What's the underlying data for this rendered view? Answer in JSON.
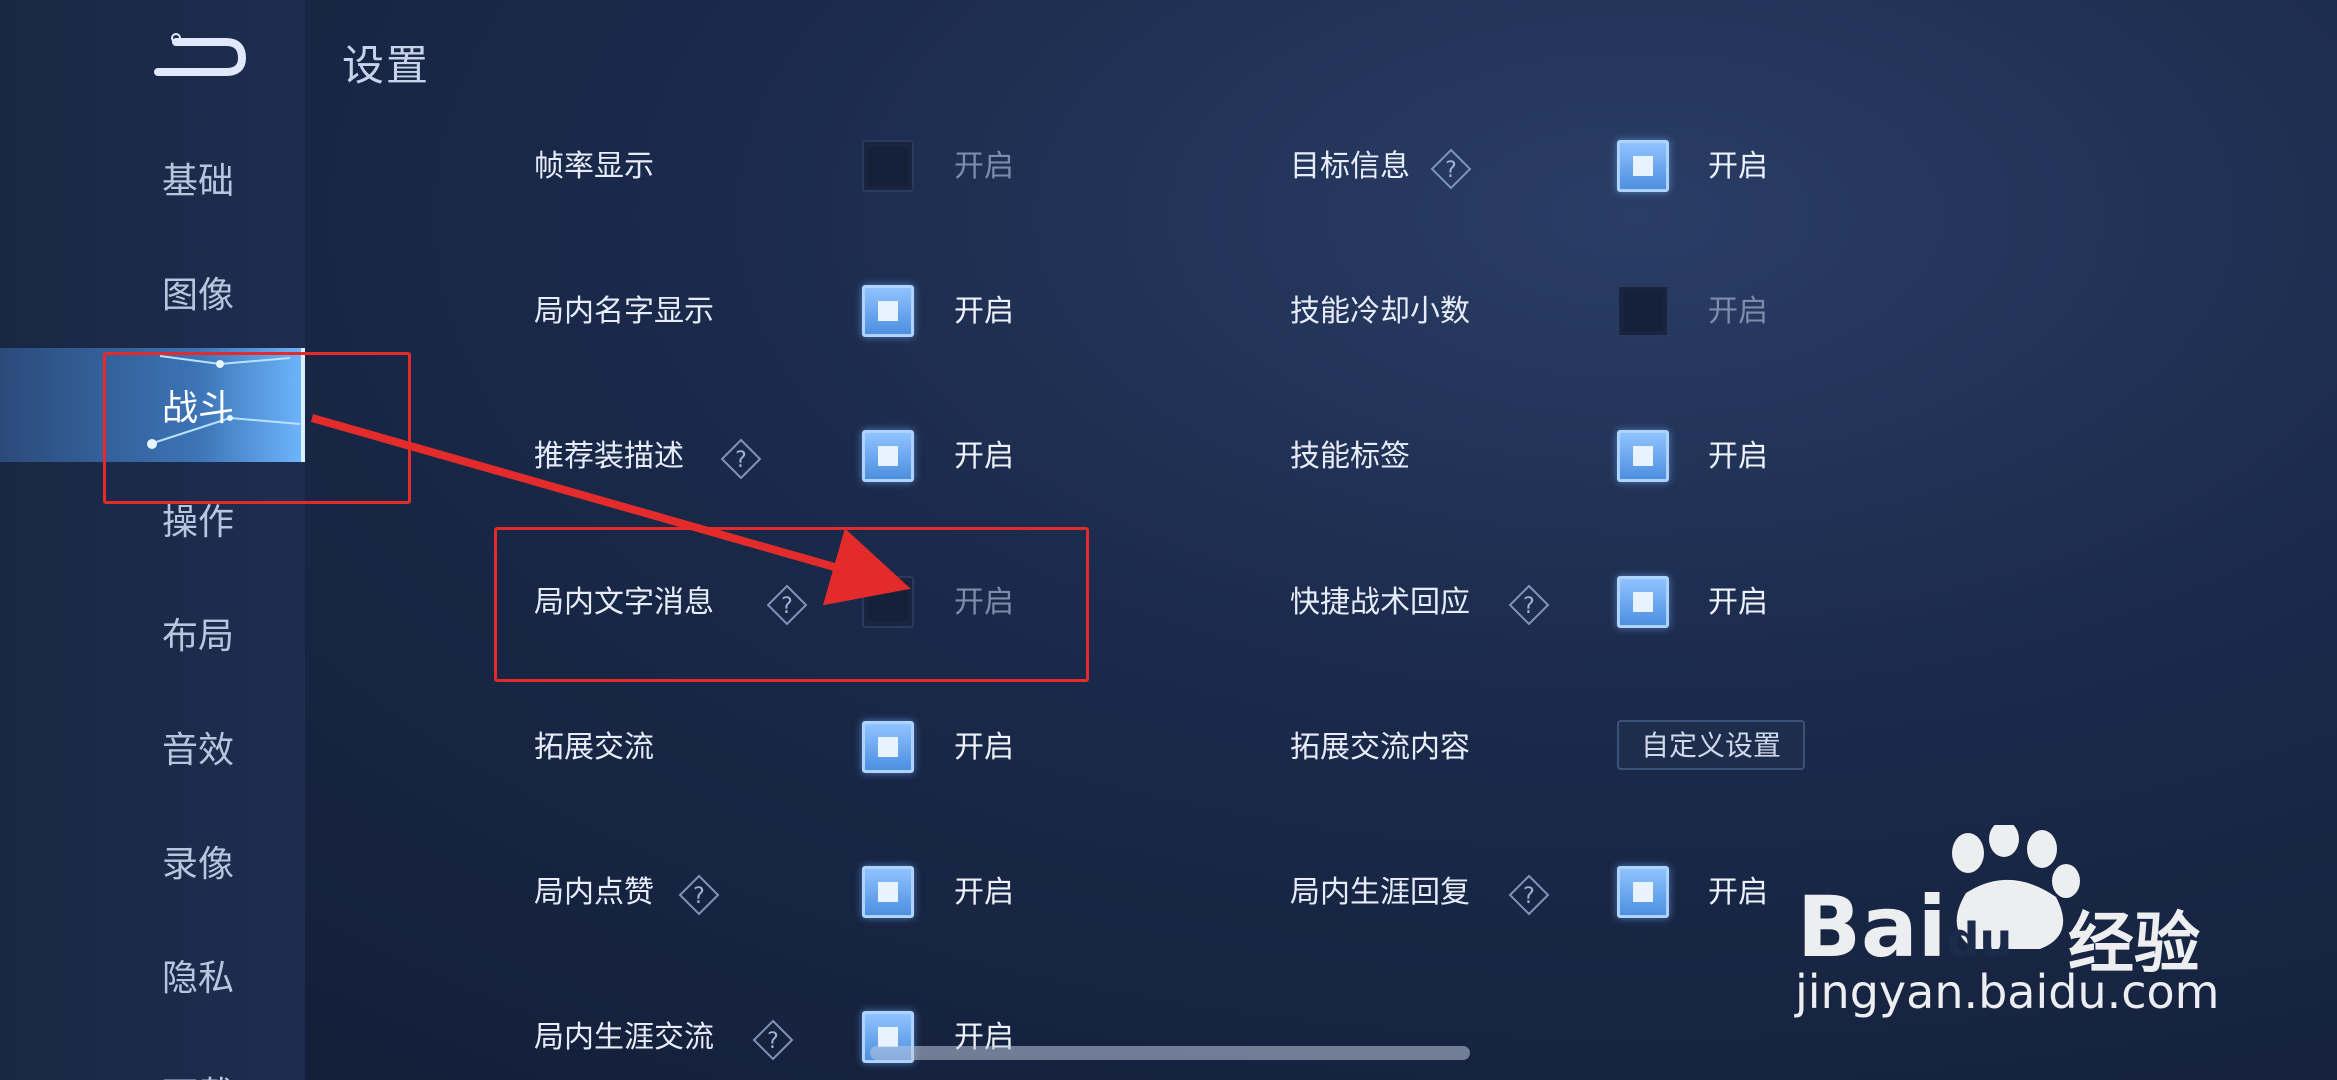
{
  "header": {
    "title": "设置"
  },
  "sidebar": {
    "items": [
      {
        "label": "基础",
        "active": false
      },
      {
        "label": "图像",
        "active": false
      },
      {
        "label": "战斗",
        "active": true
      },
      {
        "label": "操作",
        "active": false
      },
      {
        "label": "布局",
        "active": false
      },
      {
        "label": "音效",
        "active": false
      },
      {
        "label": "录像",
        "active": false
      },
      {
        "label": "隐私",
        "active": false
      },
      {
        "label": "下载",
        "active": false
      }
    ]
  },
  "settings": {
    "left": [
      {
        "label": "帧率显示",
        "help": false,
        "checked": false,
        "toggle_label": "开启"
      },
      {
        "label": "局内名字显示",
        "help": false,
        "checked": true,
        "toggle_label": "开启"
      },
      {
        "label": "推荐装描述",
        "help": true,
        "checked": true,
        "toggle_label": "开启"
      },
      {
        "label": "局内文字消息",
        "help": true,
        "checked": false,
        "toggle_label": "开启"
      },
      {
        "label": "拓展交流",
        "help": false,
        "checked": true,
        "toggle_label": "开启"
      },
      {
        "label": "局内点赞",
        "help": true,
        "checked": true,
        "toggle_label": "开启"
      },
      {
        "label": "局内生涯交流",
        "help": true,
        "checked": true,
        "toggle_label": "开启"
      }
    ],
    "right": [
      {
        "label": "目标信息",
        "help": true,
        "checked": true,
        "toggle_label": "开启"
      },
      {
        "label": "技能冷却小数",
        "help": false,
        "checked": false,
        "toggle_label": "开启"
      },
      {
        "label": "技能标签",
        "help": false,
        "checked": true,
        "toggle_label": "开启"
      },
      {
        "label": "快捷战术回应",
        "help": true,
        "checked": true,
        "toggle_label": "开启"
      },
      {
        "label": "拓展交流内容",
        "help": false,
        "button_label": "自定义设置"
      },
      {
        "label": "局内生涯回复",
        "help": true,
        "checked": true,
        "toggle_label": "开启"
      }
    ]
  },
  "watermark": {
    "brand": "Bai",
    "brand2": "du",
    "suffix": "经验",
    "url": "jingyan.baidu.com"
  },
  "colors": {
    "accent": "#6fb6ff",
    "annotation": "#e32b2b",
    "checked": "#4d8fe0"
  }
}
